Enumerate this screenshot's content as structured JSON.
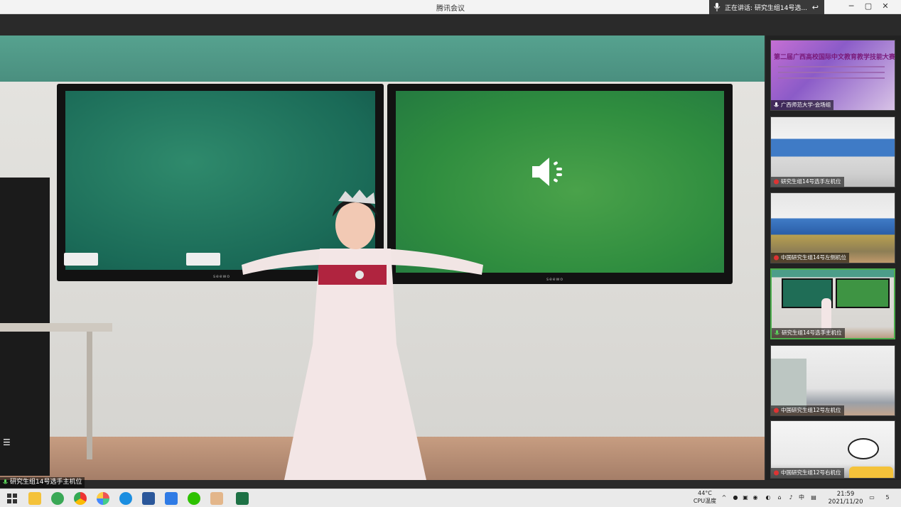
{
  "window": {
    "title": "腾讯会议",
    "speaking_prefix": "正在讲话: 研究生组14号选...",
    "controls": {
      "min": "─",
      "max": "▢",
      "close": "✕"
    }
  },
  "main_video": {
    "label": "研究生组14号选手主机位",
    "screen_brand": "seewo",
    "list_icon": "list-icon"
  },
  "participants": [
    {
      "label": "广西师范大学-会场组",
      "active": false,
      "mic": "mic-icon"
    },
    {
      "label": "研究生组14号选手左机位",
      "active": false,
      "mic": "mic-muted-icon"
    },
    {
      "label": "中国研究生组14号左侧机位",
      "active": false,
      "mic": "mic-muted-icon"
    },
    {
      "label": "研究生组14号选手主机位",
      "active": true,
      "mic": "mic-active-icon"
    },
    {
      "label": "中国研究生组12号左机位",
      "active": false,
      "mic": "mic-muted-icon"
    },
    {
      "label": "中国研究生组12号右机位",
      "active": false,
      "mic": "mic-muted-icon"
    }
  ],
  "banner_text": "第二届广西高校国际中文教育教学技能大赛",
  "taskbar": {
    "temp": "44°C",
    "cpu": "CPU温度",
    "time": "21:59",
    "date": "2021/11/20",
    "ime": "中",
    "notify_count": "5"
  },
  "colors": {
    "active_border": "#4cae4c",
    "accent": "#1a73e8"
  }
}
